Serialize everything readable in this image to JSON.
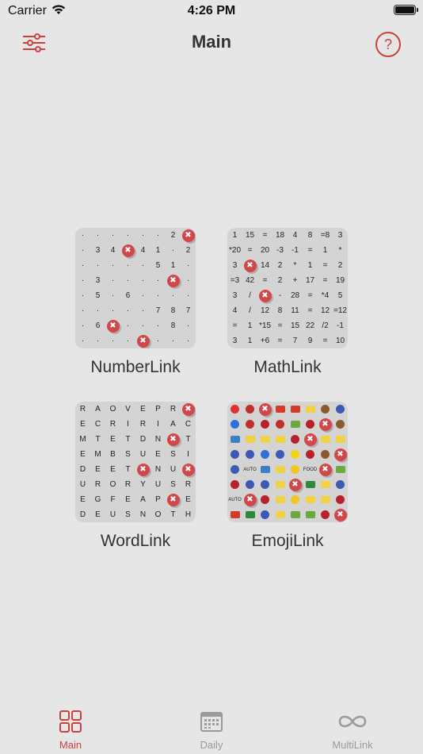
{
  "status_bar": {
    "carrier": "Carrier",
    "time": "4:26 PM"
  },
  "nav": {
    "title": "Main",
    "help_symbol": "?"
  },
  "colors": {
    "accent": "#c9413e",
    "background": "#e6e6e6",
    "tile": "#d4d4d4",
    "inactive": "#9a9a9a"
  },
  "games": [
    {
      "label": "NumberLink",
      "rows": [
        [
          "·",
          "·",
          "·",
          "·",
          "·",
          "·",
          "2",
          "x"
        ],
        [
          "·",
          "3",
          "4",
          "x",
          "4",
          "1",
          "·",
          "2"
        ],
        [
          "·",
          "·",
          "·",
          "·",
          "·",
          "5",
          "1",
          "·"
        ],
        [
          "·",
          "3",
          "·",
          "·",
          "·",
          "·",
          "x",
          "·"
        ],
        [
          "·",
          "5",
          "·",
          "6",
          "·",
          "·",
          "·",
          "·"
        ],
        [
          "·",
          "·",
          "·",
          "·",
          "·",
          "7",
          "8",
          "7"
        ],
        [
          "·",
          "6",
          "x",
          "·",
          "·",
          "·",
          "8",
          "·"
        ],
        [
          "·",
          "·",
          "·",
          "·",
          "x",
          "·",
          "·",
          "·"
        ]
      ]
    },
    {
      "label": "MathLink",
      "rows": [
        [
          "1",
          "15",
          "=",
          "18",
          "4",
          "8",
          "=8",
          "3"
        ],
        [
          "*20",
          "=",
          "20",
          "-3",
          "-1",
          "=",
          "1",
          "*"
        ],
        [
          "3",
          "x",
          "14",
          "2",
          "*",
          "1",
          "=",
          "2"
        ],
        [
          "=3",
          "42",
          "=",
          "2",
          "+",
          "17",
          "=",
          "19"
        ],
        [
          "3",
          "/",
          "x",
          "-",
          "28",
          "=",
          "*4",
          "5"
        ],
        [
          "4",
          "/",
          "12",
          "8",
          "11",
          "=",
          "12",
          "=12"
        ],
        [
          "=",
          "1",
          "*15",
          "=",
          "15",
          "22",
          "/2",
          "-1"
        ],
        [
          "3",
          "1",
          "+6",
          "=",
          "7",
          "9",
          "=",
          "10"
        ]
      ]
    },
    {
      "label": "WordLink",
      "rows": [
        [
          "R",
          "A",
          "O",
          "V",
          "E",
          "P",
          "R",
          "x"
        ],
        [
          "E",
          "C",
          "R",
          "I",
          "R",
          "I",
          "A",
          "C"
        ],
        [
          "M",
          "T",
          "E",
          "T",
          "D",
          "N",
          "x",
          "T"
        ],
        [
          "E",
          "M",
          "B",
          "S",
          "U",
          "E",
          "S",
          "I"
        ],
        [
          "D",
          "E",
          "E",
          "T",
          "x",
          "N",
          "U",
          "x"
        ],
        [
          "U",
          "R",
          "O",
          "R",
          "Y",
          "U",
          "S",
          "R"
        ],
        [
          "E",
          "G",
          "F",
          "E",
          "A",
          "P",
          "x",
          "E"
        ],
        [
          "D",
          "E",
          "U",
          "S",
          "N",
          "O",
          "T",
          "H"
        ]
      ]
    },
    {
      "label": "EmojiLink",
      "rows": [
        [
          "red-circle",
          "ladybug",
          "x",
          "car",
          "car",
          "banana",
          "coconut",
          "blueberry"
        ],
        [
          "blue-circle",
          "ladybug",
          "cherry",
          "ladybug",
          "leaf",
          "cherry",
          "x",
          "coconut"
        ],
        [
          "bus",
          "banana",
          "banana",
          "banana",
          "cherry",
          "x",
          "banana",
          "banana"
        ],
        [
          "blueberry",
          "blueberry",
          "blue-circle",
          "blueberry",
          "yellow-circle",
          "cherry",
          "coconut",
          "x"
        ],
        [
          "blueberry",
          "AUTO",
          "bus",
          "banana",
          "chick",
          "FOOD",
          "x",
          "leaf"
        ],
        [
          "cherry",
          "blueberry",
          "blueberry",
          "banana",
          "x",
          "truck",
          "banana",
          "blueberry"
        ],
        [
          "AUTO",
          "x",
          "cherry",
          "banana",
          "chick",
          "banana",
          "banana",
          "cherry"
        ],
        [
          "car",
          "truck",
          "blueberry",
          "banana",
          "leaf",
          "leaf",
          "cherry",
          "x"
        ]
      ]
    }
  ],
  "tabs": [
    {
      "label": "Main",
      "icon": "grid-icon",
      "active": true
    },
    {
      "label": "Daily",
      "icon": "calendar-icon",
      "active": false
    },
    {
      "label": "MultiLink",
      "icon": "infinity-icon",
      "active": false
    }
  ]
}
